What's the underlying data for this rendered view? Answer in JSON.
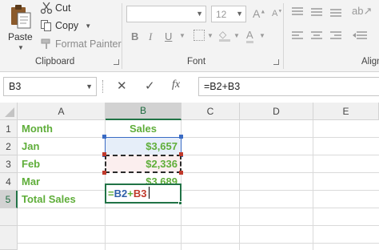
{
  "ribbon": {
    "clipboard": {
      "paste_label": "Paste",
      "cut_label": "Cut",
      "copy_label": "Copy",
      "format_painter_label": "Format Painter",
      "group_label": "Clipboard"
    },
    "font": {
      "font_name": "",
      "font_size": "12",
      "group_label": "Font",
      "bold_glyph": "B",
      "italic_glyph": "I",
      "underline_glyph": "U"
    },
    "alignment": {
      "group_label": "Align"
    }
  },
  "formula_bar": {
    "name_box": "B3",
    "cancel_glyph": "✕",
    "enter_glyph": "✓",
    "function_glyph": "fx",
    "formula": "=B2+B3"
  },
  "grid": {
    "columns": [
      "A",
      "B",
      "C",
      "D",
      "E"
    ],
    "rows": [
      "1",
      "2",
      "3",
      "4",
      "5"
    ],
    "selected_column": "B",
    "selected_row": "5",
    "cells": {
      "A1": "Month",
      "B1": "Sales",
      "A2": "Jan",
      "B2": "$3,657",
      "A3": "Feb",
      "B3": "$2,336",
      "A4": "Mar",
      "B4": "$3,689",
      "A5": "Total Sales"
    },
    "editing": {
      "prefix": "=",
      "ref1": "B2",
      "operator": "+",
      "ref2": "B3"
    }
  },
  "colors": {
    "accent": "#217346",
    "label_green": "#5fae3a",
    "ref1_blue": "#2e5fa8",
    "ref2_red": "#c0392b",
    "ref1_fill": "#e6eef9",
    "ref2_fill": "#fbeeee"
  },
  "icons": [
    "paste-icon",
    "scissors-icon",
    "copy-icon",
    "format-painter-icon",
    "cancel-icon",
    "enter-icon",
    "function-icon"
  ]
}
